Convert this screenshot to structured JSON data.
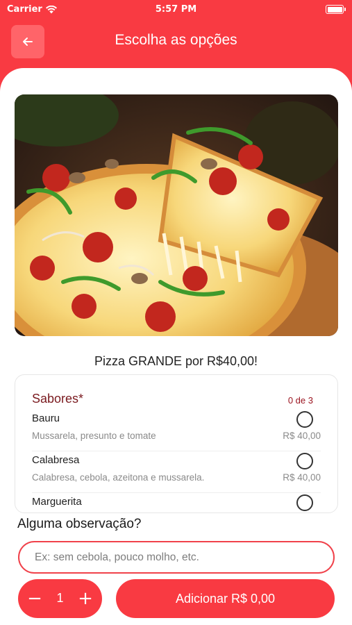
{
  "status_bar": {
    "carrier": "Carrier",
    "time": "5:57 PM"
  },
  "header": {
    "title": "Escolha as opções",
    "back_icon": "arrow-left-icon"
  },
  "hero": {
    "alt": "pizza-photo"
  },
  "headline": "Pizza GRANDE por R$40,00!",
  "flavors": {
    "title": "Sabores*",
    "count": "0 de 3",
    "items": [
      {
        "name": "Bauru",
        "description": "Mussarela, presunto e tomate",
        "price": "R$ 40,00"
      },
      {
        "name": "Calabresa",
        "description": "Calabresa, cebola, azeitona e mussarela.",
        "price": "R$ 40,00"
      },
      {
        "name": "Marguerita",
        "description": "",
        "price": ""
      }
    ]
  },
  "observation": {
    "label": "Alguma observação?",
    "placeholder": "Ex: sem cebola, pouco molho, etc."
  },
  "stepper": {
    "minus": "−",
    "quantity": "1",
    "plus": "+"
  },
  "add_button": {
    "label": "Adicionar R$ 0,00"
  },
  "colors": {
    "brand": "#f93a42",
    "accent_dark": "#7a1a1f"
  }
}
